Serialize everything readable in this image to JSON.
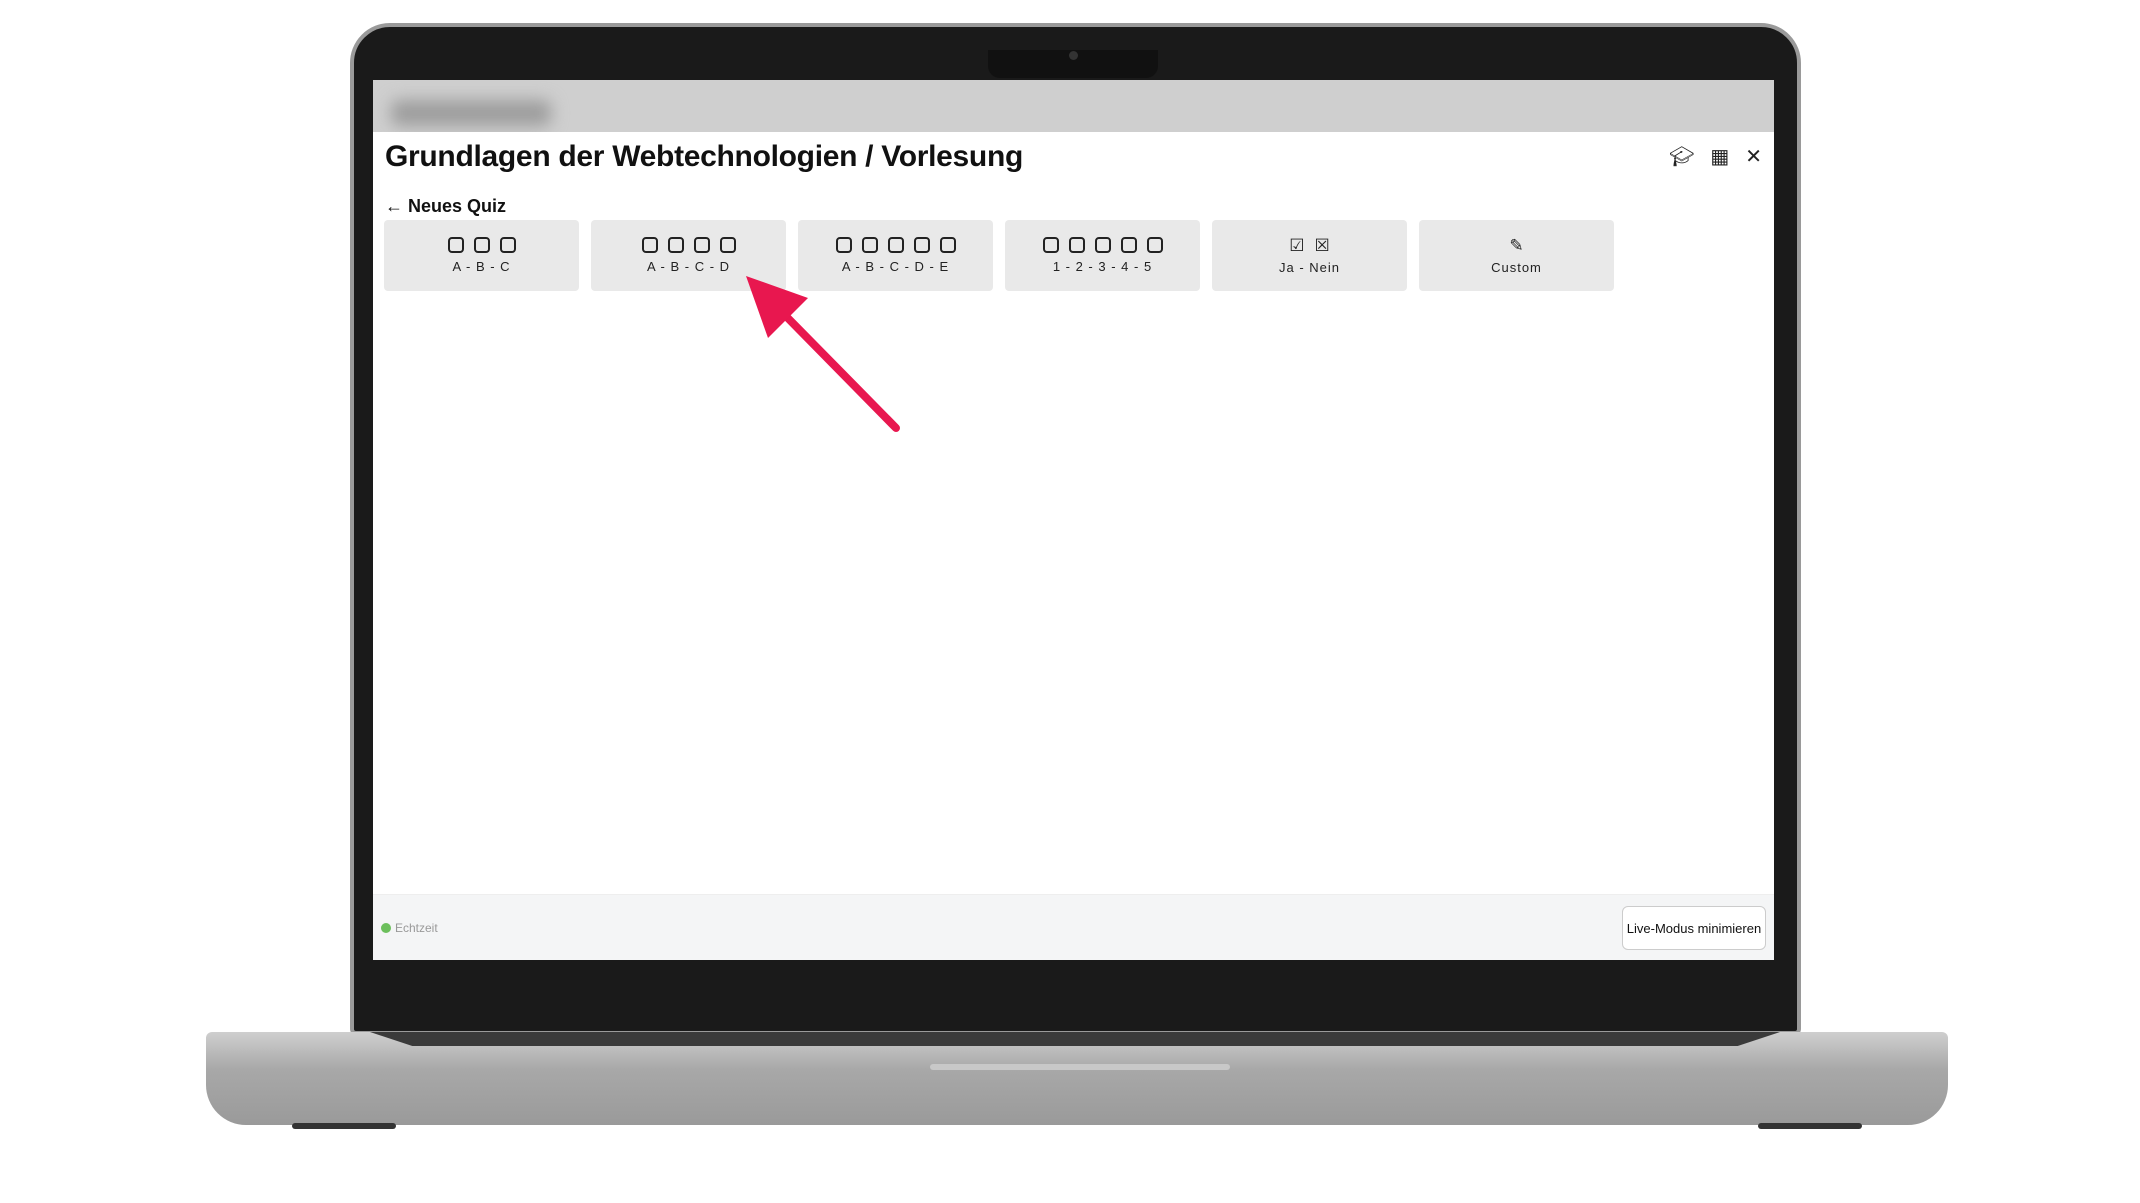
{
  "modal": {
    "title": "Grundlagen der Webtechnologien / Vorlesung",
    "icons": [
      "graduation-cap-icon",
      "qr-code-icon",
      "close-icon"
    ],
    "back_label": "Neues Quiz"
  },
  "cards": [
    {
      "label": "A - B - C",
      "boxes": 3,
      "type": "squares"
    },
    {
      "label": "A - B - C - D",
      "boxes": 4,
      "type": "squares"
    },
    {
      "label": "A - B - C - D - E",
      "boxes": 5,
      "type": "squares"
    },
    {
      "label": "1 - 2 - 3 - 4 - 5",
      "boxes": 5,
      "type": "squares"
    },
    {
      "label": "Ja - Nein",
      "type": "check-cross"
    },
    {
      "label": "Custom",
      "type": "edit"
    }
  ],
  "footer": {
    "status": "Echtzeit",
    "status_color": "#6cbf5c",
    "minimize_label": "Live-Modus minimieren"
  },
  "annotation": {
    "arrow_color": "#e8174f"
  }
}
